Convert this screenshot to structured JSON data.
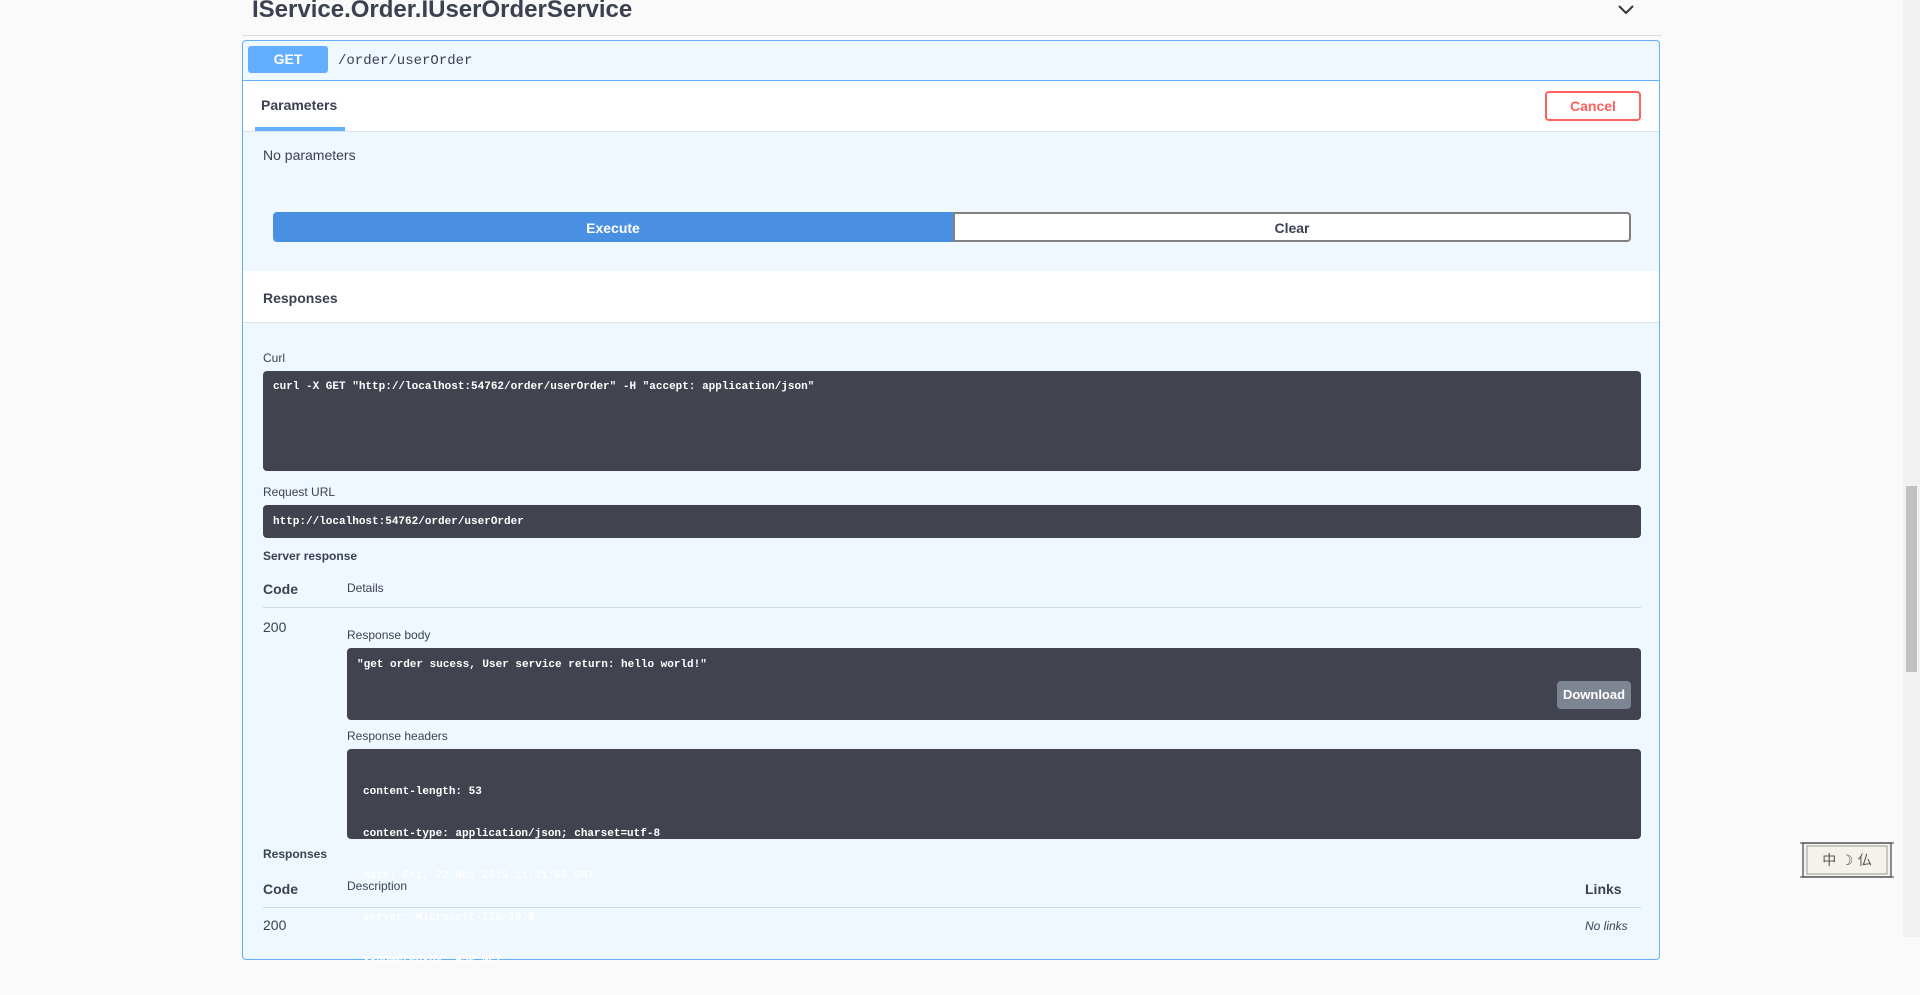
{
  "section": {
    "title": "IService.Order.IUserOrderService"
  },
  "operation": {
    "method": "GET",
    "path": "/order/userOrder"
  },
  "params_tab": {
    "label": "Parameters",
    "cancel_label": "Cancel",
    "no_params": "No parameters"
  },
  "actions": {
    "execute_label": "Execute",
    "clear_label": "Clear"
  },
  "responses_header": "Responses",
  "curl": {
    "label": "Curl",
    "command": "curl -X GET \"http://localhost:54762/order/userOrder\" -H \"accept: application/json\""
  },
  "request_url": {
    "label": "Request URL",
    "value": "http://localhost:54762/order/userOrder"
  },
  "server_response": {
    "label": "Server response",
    "col_code": "Code",
    "col_details": "Details",
    "code": "200",
    "body_label": "Response body",
    "body": "\"get order sucess, User service return: hello world!\"",
    "download_label": "Download",
    "headers_label": "Response headers",
    "headers": [
      "content-length: 53",
      "content-type: application/json; charset=utf-8",
      "date: Fri, 22 Nov 2019 11:31:56 GMT",
      "server: Microsoft-IIS/10.0",
      "x-powered-by: ASP.NET"
    ]
  },
  "responses_table": {
    "label": "Responses",
    "col_code": "Code",
    "col_description": "Description",
    "col_links": "Links",
    "row_code": "200",
    "row_links": "No links"
  },
  "stamp": {
    "text": "中 ☽ 仏"
  },
  "colors": {
    "get": "#61affe",
    "execute": "#4990e2",
    "cancel": "#ff6060",
    "code_bg": "#41444e"
  }
}
